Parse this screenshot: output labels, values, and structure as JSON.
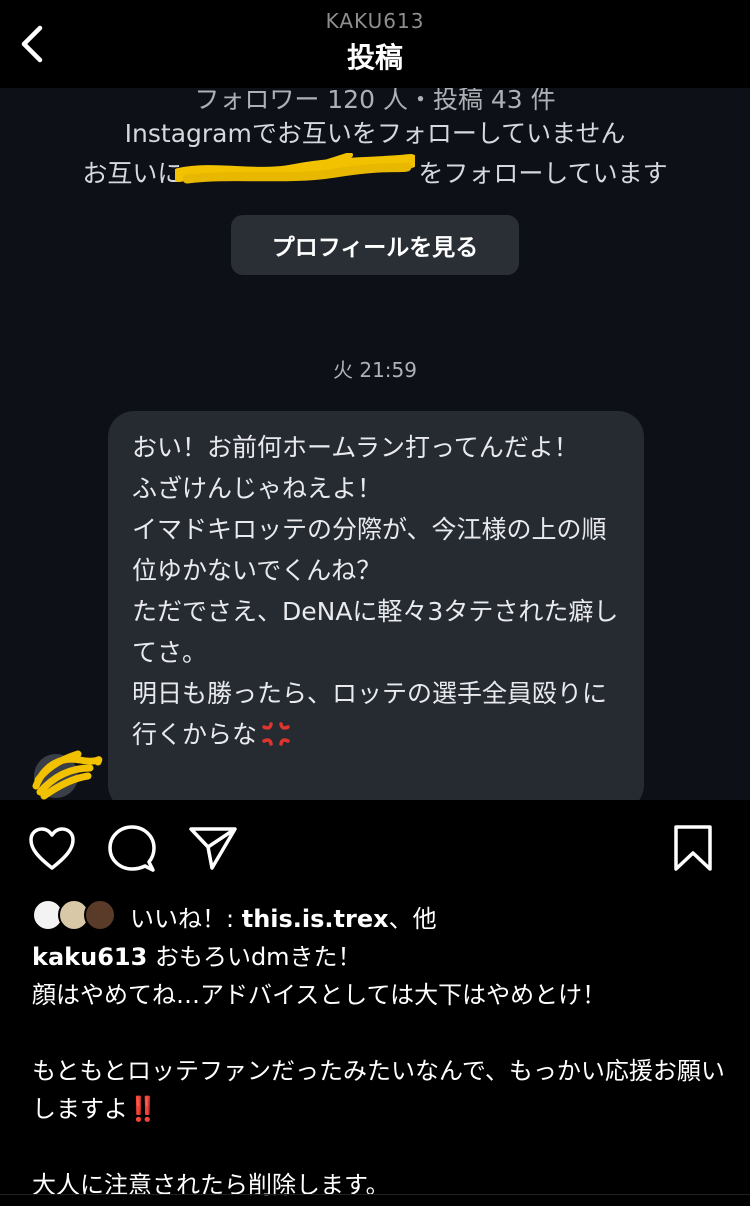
{
  "header": {
    "username": "KAKU613",
    "title": "投稿"
  },
  "dm": {
    "stats_cutoff": "フォロワー 120 人・投稿 43 件",
    "not_following": "Instagramでお互いをフォローしていません",
    "mutual_prefix": "お互いに",
    "mutual_suffix": "をフォローしています",
    "profile_button": "プロフィールを見る",
    "timestamp": "火 21:59",
    "message": "おい！お前何ホームラン打ってんだよ！\nふざけんじゃねえよ！\nイマドキロッテの分際が、今江様の上の順位ゆかないでくんね？\nただでさえ、DeNAに軽々3タテされた癖してさ。\n明日も勝ったら、ロッテの選手全員殴りに行くからな",
    "emoji": "anger-symbol"
  },
  "likes": {
    "prefix": "いいね！: ",
    "user": "this.is.trex",
    "suffix": "、他"
  },
  "caption": {
    "user": "kaku613",
    "line1": " おもろいdmきた！",
    "line2": "顔はやめてね…アドバイスとしては大下はやめとけ！",
    "line3": "もともとロッテファンだったみたいなんで、もっかい応援お願いしますよ",
    "line3_emoji": "‼️",
    "line4": "大人に注意されたら削除します。"
  },
  "colors": {
    "background": "#000000",
    "dm_background": "#0d1117",
    "bubble": "#262a31",
    "button": "#2a2f36",
    "scribble": "#f2c200",
    "alert_red": "#e5282e"
  }
}
